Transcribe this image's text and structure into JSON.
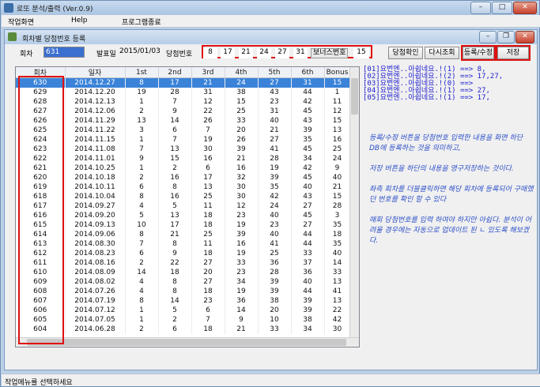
{
  "app_title": "로또 분석/출력 (Ver.0.9)",
  "menu": [
    "작업화면",
    "Help",
    "프로그램종료"
  ],
  "window_title": "회차별 당첨번호 등록",
  "form": {
    "round_label": "회차",
    "round_value": "631",
    "date_label": "발표일",
    "date_value": "2015/01/03",
    "numbers_label": "당첨번호",
    "numbers": [
      "8",
      "17",
      "21",
      "24",
      "27",
      "31"
    ],
    "bonus_label": "보너스번호",
    "bonus_value": "15"
  },
  "buttons": {
    "check": "당첨확인",
    "reload": "다시조회",
    "register": "등록/수정",
    "save": "저장"
  },
  "columns": [
    "회차",
    "일자",
    "1st",
    "2nd",
    "3rd",
    "4th",
    "5th",
    "6th",
    "Bonus"
  ],
  "rows": [
    [
      "630",
      "2014.12.27",
      "8",
      "17",
      "21",
      "24",
      "27",
      "31",
      "15"
    ],
    [
      "629",
      "2014.12.20",
      "19",
      "28",
      "31",
      "38",
      "43",
      "44",
      "1"
    ],
    [
      "628",
      "2014.12.13",
      "1",
      "7",
      "12",
      "15",
      "23",
      "42",
      "11"
    ],
    [
      "627",
      "2014.12.06",
      "2",
      "9",
      "22",
      "25",
      "31",
      "45",
      "12"
    ],
    [
      "626",
      "2014.11.29",
      "13",
      "14",
      "26",
      "33",
      "40",
      "43",
      "15"
    ],
    [
      "625",
      "2014.11.22",
      "3",
      "6",
      "7",
      "20",
      "21",
      "39",
      "13"
    ],
    [
      "624",
      "2014.11.15",
      "1",
      "7",
      "19",
      "26",
      "27",
      "35",
      "16"
    ],
    [
      "623",
      "2014.11.08",
      "7",
      "13",
      "30",
      "39",
      "41",
      "45",
      "25"
    ],
    [
      "622",
      "2014.11.01",
      "9",
      "15",
      "16",
      "21",
      "28",
      "34",
      "24"
    ],
    [
      "621",
      "2014.10.25",
      "1",
      "2",
      "6",
      "16",
      "19",
      "42",
      "9"
    ],
    [
      "620",
      "2014.10.18",
      "2",
      "16",
      "17",
      "32",
      "39",
      "45",
      "40"
    ],
    [
      "619",
      "2014.10.11",
      "6",
      "8",
      "13",
      "30",
      "35",
      "40",
      "21"
    ],
    [
      "618",
      "2014.10.04",
      "8",
      "16",
      "25",
      "30",
      "42",
      "43",
      "15"
    ],
    [
      "617",
      "2014.09.27",
      "4",
      "5",
      "11",
      "12",
      "24",
      "27",
      "28"
    ],
    [
      "616",
      "2014.09.20",
      "5",
      "13",
      "18",
      "23",
      "40",
      "45",
      "3"
    ],
    [
      "615",
      "2014.09.13",
      "10",
      "17",
      "18",
      "19",
      "23",
      "27",
      "35"
    ],
    [
      "614",
      "2014.09.06",
      "8",
      "21",
      "25",
      "39",
      "40",
      "44",
      "18"
    ],
    [
      "613",
      "2014.08.30",
      "7",
      "8",
      "11",
      "16",
      "41",
      "44",
      "35"
    ],
    [
      "612",
      "2014.08.23",
      "6",
      "9",
      "18",
      "19",
      "25",
      "33",
      "40"
    ],
    [
      "611",
      "2014.08.16",
      "2",
      "22",
      "27",
      "33",
      "36",
      "37",
      "14"
    ],
    [
      "610",
      "2014.08.09",
      "14",
      "18",
      "20",
      "23",
      "28",
      "36",
      "33"
    ],
    [
      "609",
      "2014.08.02",
      "4",
      "8",
      "27",
      "34",
      "39",
      "40",
      "13"
    ],
    [
      "608",
      "2014.07.26",
      "4",
      "8",
      "18",
      "19",
      "39",
      "44",
      "41"
    ],
    [
      "607",
      "2014.07.19",
      "8",
      "14",
      "23",
      "36",
      "38",
      "39",
      "13"
    ],
    [
      "606",
      "2014.07.12",
      "1",
      "5",
      "6",
      "14",
      "20",
      "39",
      "22"
    ],
    [
      "605",
      "2014.07.05",
      "1",
      "2",
      "7",
      "9",
      "10",
      "38",
      "42"
    ],
    [
      "604",
      "2014.06.28",
      "2",
      "6",
      "18",
      "21",
      "33",
      "34",
      "30"
    ]
  ],
  "results": [
    "[01]요번엔..아쉽네요.!(1) ==> 8,",
    "[02]요번엔..아쉽네요.!(2) ==> 17,27,",
    "[03]요번엔..아쉽네요.!(0) ==>",
    "[04]요번엔..아쉽네요.!(1) ==> 27,",
    "[05]요번엔..아쉽네요.!(1) ==> 17,"
  ],
  "notes": [
    "등록/수정 버튼을 당첨번호 입력한 내용을 화면 하단 DB에 등록하는 것을 의미하고,",
    "저장 버튼을 하단의 내용을 영구저장하는 것이다.",
    "좌측 회차를 더블클릭하면 해당 회차에 등록되어 구매했던 번호를 확인 할 수 있다",
    "매회 당첨번호를 입력 하여야 하지만 아쉽다. 분석이 어려울 경우에는 자동으로 업데이트 된 ㄴ 있도록 해보겠다."
  ],
  "status": "작업메뉴를 선택하세요",
  "selected_row_color": "#3a83d9",
  "highlight_color": "#e01010"
}
